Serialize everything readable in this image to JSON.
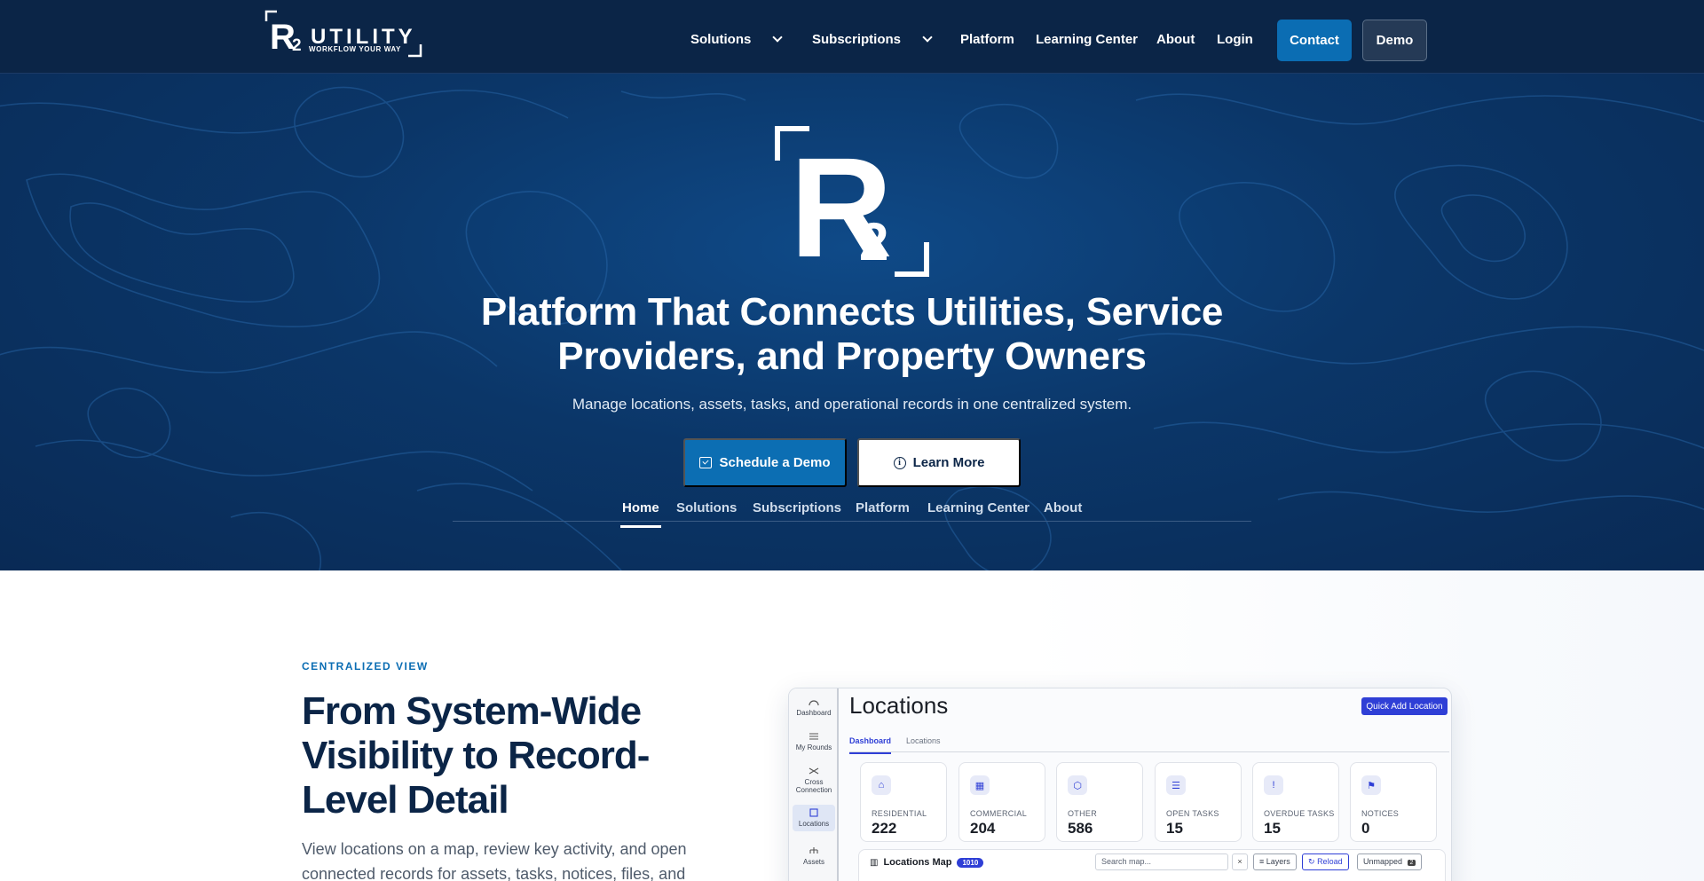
{
  "brand": {
    "name": "UTILITY",
    "tagline": "WORKFLOW YOUR WAY"
  },
  "nav": {
    "solutions": "Solutions",
    "subscriptions": "Subscriptions",
    "platform": "Platform",
    "learning_center": "Learning Center",
    "about": "About",
    "login": "Login",
    "contact": "Contact",
    "demo": "Demo"
  },
  "hero": {
    "title": "Platform That Connects Utilities, Service Providers, and Property Owners",
    "subtitle": "Manage locations, assets, tasks, and operational records in one centralized system.",
    "schedule_demo": "Schedule a Demo",
    "learn_more": "Learn More"
  },
  "subnav": {
    "home": "Home",
    "solutions": "Solutions",
    "subscriptions": "Subscriptions",
    "platform": "Platform",
    "learning_center": "Learning Center",
    "about": "About"
  },
  "section": {
    "eyebrow": "CENTRALIZED VIEW",
    "title": "From System-Wide Visibility to Record-Level Detail",
    "body": "View locations on a map, review key activity, and open connected records for assets, tasks, notices, files, and"
  },
  "mockup": {
    "sidebar": {
      "dashboard": "Dashboard",
      "my_rounds": "My Rounds",
      "cross_connection": "Cross Connection",
      "locations": "Locations",
      "assets": "Assets"
    },
    "title": "Locations",
    "quick_add": "Quick Add Location",
    "tab_dashboard": "Dashboard",
    "tab_locations": "Locations",
    "cards": {
      "residential": {
        "label": "RESIDENTIAL",
        "value": "222"
      },
      "commercial": {
        "label": "COMMERCIAL",
        "value": "204"
      },
      "other": {
        "label": "OTHER",
        "value": "586"
      },
      "open_tasks": {
        "label": "OPEN TASKS",
        "value": "15"
      },
      "overdue_tasks": {
        "label": "OVERDUE TASKS",
        "value": "15"
      },
      "notices": {
        "label": "NOTICES",
        "value": "0"
      }
    },
    "map": {
      "title": "Locations Map",
      "count": "1010",
      "search_placeholder": "Search map...",
      "clear": "×",
      "layers": "Layers",
      "reload": "Reload",
      "unmapped": "Unmapped",
      "unmapped_count": "2"
    }
  },
  "colors": {
    "nav_bg": "#0b2547",
    "accent": "#0b6db3",
    "mockup_accent": "#2f3fd6"
  }
}
